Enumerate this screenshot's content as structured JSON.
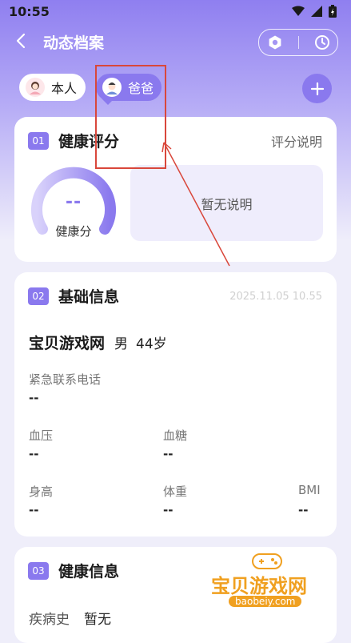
{
  "status": {
    "time": "10:55"
  },
  "header": {
    "title": "动态档案"
  },
  "members": [
    {
      "label": "本人",
      "selected": false
    },
    {
      "label": "爸爸",
      "selected": true
    }
  ],
  "health_score": {
    "num": "01",
    "title": "健康评分",
    "link": "评分说明",
    "score": "--",
    "score_label": "健康分",
    "note": "暂无说明"
  },
  "basic_info": {
    "num": "02",
    "title": "基础信息",
    "timestamp": "2025.11.05 10.55",
    "name": "宝贝游戏网",
    "gender": "男",
    "age": "44岁",
    "fields": {
      "emergency_phone": {
        "label": "紧急联系电话",
        "value": "--"
      },
      "blood_pressure": {
        "label": "血压",
        "value": "--"
      },
      "blood_sugar": {
        "label": "血糖",
        "value": "--"
      },
      "height": {
        "label": "身高",
        "value": "--"
      },
      "weight": {
        "label": "体重",
        "value": "--"
      },
      "bmi": {
        "label": "BMI",
        "value": "--"
      }
    }
  },
  "health_info": {
    "num": "03",
    "title": "健康信息",
    "disease_history_label": "疾病史",
    "disease_history_value": "暂无"
  },
  "watermark": {
    "text": "宝贝游戏网",
    "url": "baobeiy.com"
  },
  "colors": {
    "accent": "#8a79ee",
    "annotation": "#d9473b",
    "watermark": "#f0a020"
  }
}
